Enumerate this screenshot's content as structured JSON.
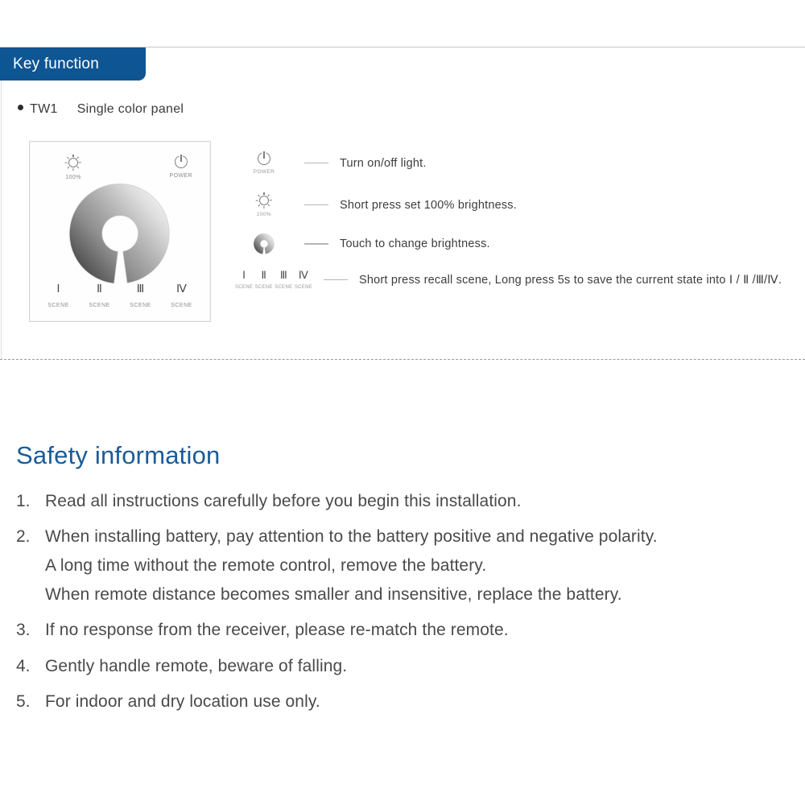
{
  "section": {
    "banner_label": "Key function"
  },
  "model": {
    "bullet": "●",
    "code": "TW1",
    "name": "Single color panel"
  },
  "panel": {
    "brightness_icon_name": "brightness-icon",
    "brightness_caption": "100%",
    "power_icon_name": "power-icon",
    "power_caption": "POWER",
    "wheel_name": "brightness-wheel",
    "scenes": [
      {
        "numeral": "Ⅰ",
        "caption": "SCENE"
      },
      {
        "numeral": "Ⅱ",
        "caption": "SCENE"
      },
      {
        "numeral": "Ⅲ",
        "caption": "SCENE"
      },
      {
        "numeral": "Ⅳ",
        "caption": "SCENE"
      }
    ]
  },
  "legend": {
    "rows": [
      {
        "icon": "power-icon",
        "caption": "POWER",
        "text": "Turn on/off light."
      },
      {
        "icon": "brightness-icon",
        "caption": "100%",
        "text": "Short press set 100% brightness."
      },
      {
        "icon": "brightness-wheel-icon",
        "caption": "",
        "text": "Touch to change brightness."
      },
      {
        "icon": "scene-buttons-icon",
        "caption": "",
        "text": "Short press recall scene, Long press 5s to save the current state into Ⅰ / Ⅱ /Ⅲ/Ⅳ."
      }
    ],
    "scene_numerals": [
      {
        "numeral": "Ⅰ",
        "caption": "SCENE"
      },
      {
        "numeral": "Ⅱ",
        "caption": "SCENE"
      },
      {
        "numeral": "Ⅲ",
        "caption": "SCENE"
      },
      {
        "numeral": "Ⅳ",
        "caption": "SCENE"
      }
    ]
  },
  "safety": {
    "title": "Safety information",
    "items": [
      {
        "number": "1.",
        "lines": [
          "Read all instructions carefully before you begin this installation."
        ]
      },
      {
        "number": "2.",
        "lines": [
          "When installing battery, pay attention to the battery positive and negative polarity.",
          "A long time without the remote control, remove the battery.",
          "When remote distance becomes smaller and insensitive, replace the battery."
        ]
      },
      {
        "number": "3.",
        "lines": [
          "If no response from the receiver, please re-match the remote."
        ]
      },
      {
        "number": "4.",
        "lines": [
          "Gently handle remote, beware of falling."
        ]
      },
      {
        "number": "5.",
        "lines": [
          "For indoor and dry location use only."
        ]
      }
    ]
  },
  "colors": {
    "banner_blue": "#0e5593",
    "title_blue": "#1a5b98",
    "body_gray": "#4a4a4a",
    "rule_gray": "#c9c9c9",
    "dash_gray": "#9b9b9b"
  }
}
